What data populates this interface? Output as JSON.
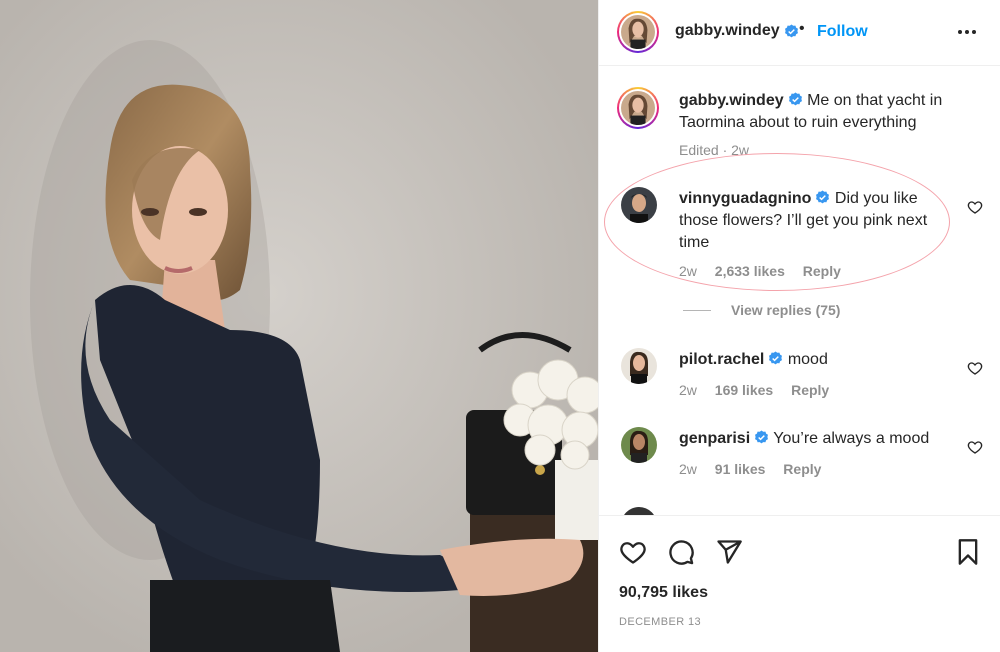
{
  "post": {
    "author": "gabby.windey",
    "follow_label": "Follow",
    "dot": "•",
    "caption": "Me on that yacht in Taormina about to ruin everything",
    "caption_meta": "Edited · 2w",
    "likes": "90,795 likes",
    "date": "DECEMBER 13"
  },
  "comments": [
    {
      "user": "vinnyguadagnino",
      "text": "Did you like those flowers? I’ll get you pink next time",
      "time": "2w",
      "likes": "2,633 likes",
      "reply_label": "Reply",
      "view_replies": "View replies (75)"
    },
    {
      "user": "pilot.rachel",
      "text": "mood",
      "time": "2w",
      "likes": "169 likes",
      "reply_label": "Reply"
    },
    {
      "user": "genparisi",
      "text": "You’re always a mood",
      "time": "2w",
      "likes": "91 likes",
      "reply_label": "Reply"
    }
  ],
  "icons": {
    "more": "more-options-icon",
    "like": "heart-icon",
    "comment": "comment-icon",
    "share": "share-icon",
    "save": "bookmark-icon",
    "verified": "verified-badge-icon"
  },
  "colors": {
    "accent": "#0095f6",
    "verified": "#3897f0",
    "muted": "#8e8e8e",
    "highlight_annotation": "#f4a3ab"
  }
}
